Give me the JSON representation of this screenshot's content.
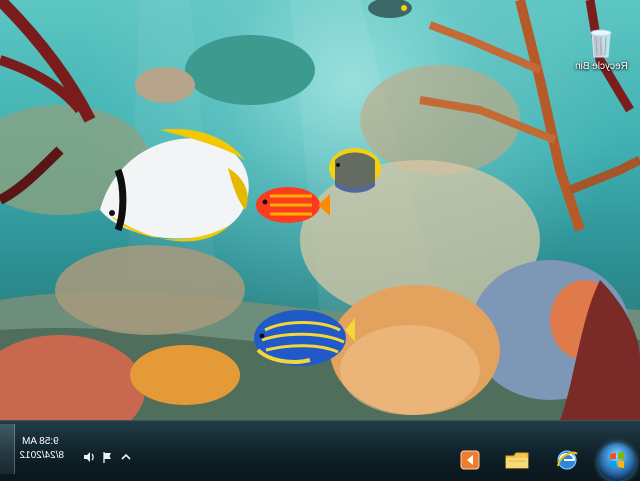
{
  "desktop": {
    "wallpaper": "underwater coral reef with tropical fish",
    "icons": [
      {
        "label": "Recycle Bin",
        "icon": "recycle-bin-icon"
      }
    ]
  },
  "taskbar": {
    "clock": {
      "time": "9:58 AM",
      "date": "8/24/2012"
    },
    "tray_icons": [
      "speaker-icon",
      "flag-icon",
      "show-hidden-icons-arrow"
    ],
    "pinned_apps": [
      {
        "name": "media-player",
        "icon": "media-player-icon"
      },
      {
        "name": "windows-explorer",
        "icon": "folder-icon"
      },
      {
        "name": "internet-explorer",
        "icon": "internet-explorer-icon"
      }
    ],
    "start_button": {
      "icon": "windows-logo-icon"
    }
  },
  "colors": {
    "water_light": "#5cc6c2",
    "water_dark": "#2b6f6a",
    "taskbar": "#14262e",
    "start_orb": "#3c8fd0"
  }
}
